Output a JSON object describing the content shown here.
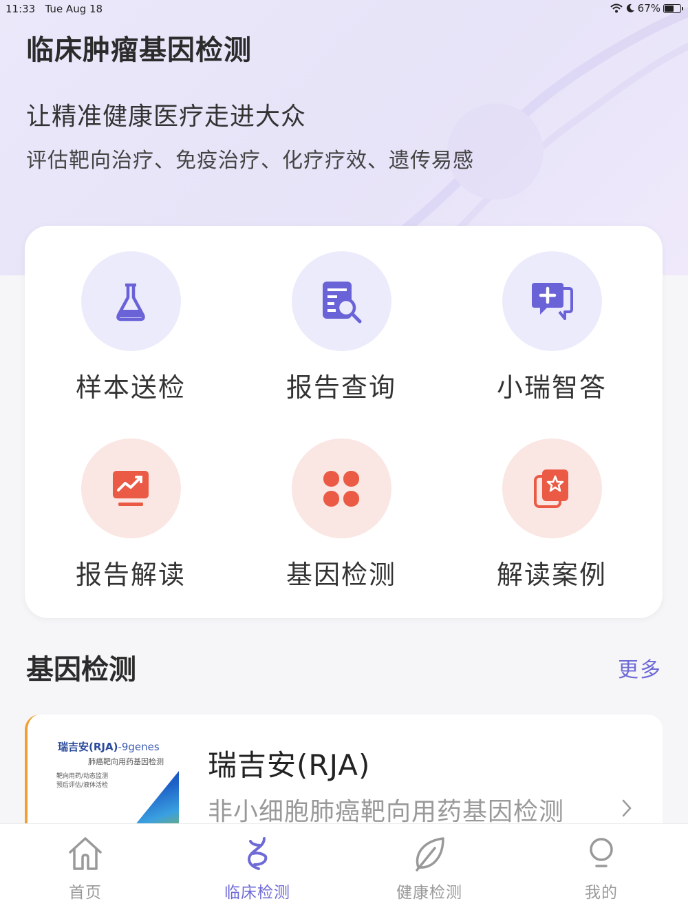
{
  "status_bar": {
    "time": "11:33",
    "date": "Tue Aug 18",
    "battery": "67%",
    "battery_level": 0.67
  },
  "hero": {
    "title": "临床肿瘤基因检测",
    "subtitle": "让精准健康医疗走进大众",
    "tagline": "评估靶向治疗、免疫治疗、化疗疗效、遗传易感"
  },
  "services": [
    {
      "label": "样本送检",
      "icon": "flask-icon"
    },
    {
      "label": "报告查询",
      "icon": "document-search-icon"
    },
    {
      "label": "小瑞智答",
      "icon": "chat-plus-icon"
    },
    {
      "label": "报告解读",
      "icon": "chart-trend-icon"
    },
    {
      "label": "基因检测",
      "icon": "four-petal-icon"
    },
    {
      "label": "解读案例",
      "icon": "star-cards-icon"
    }
  ],
  "section": {
    "title": "基因检测",
    "more": "更多"
  },
  "product": {
    "thumb_title": "瑞吉安(RJA)",
    "thumb_title_suffix": "-9genes",
    "thumb_subtitle": "肺癌靶向用药基因检测",
    "thumb_note1": "靶向用药/动态监测",
    "thumb_note2": "预后评估/液体活检",
    "name": "瑞吉安(RJA)",
    "description": "非小细胞肺癌靶向用药基因检测"
  },
  "tabs": [
    {
      "label": "首页",
      "icon": "home-icon",
      "active": false
    },
    {
      "label": "临床检测",
      "icon": "dna-icon",
      "active": true
    },
    {
      "label": "健康检测",
      "icon": "leaf-icon",
      "active": false
    },
    {
      "label": "我的",
      "icon": "profile-icon",
      "active": false
    }
  ],
  "colors": {
    "accent": "#6e6ad6",
    "purple_icon": "#6a63d8",
    "red_icon": "#ea5a45",
    "highlight": "#f0a032"
  }
}
